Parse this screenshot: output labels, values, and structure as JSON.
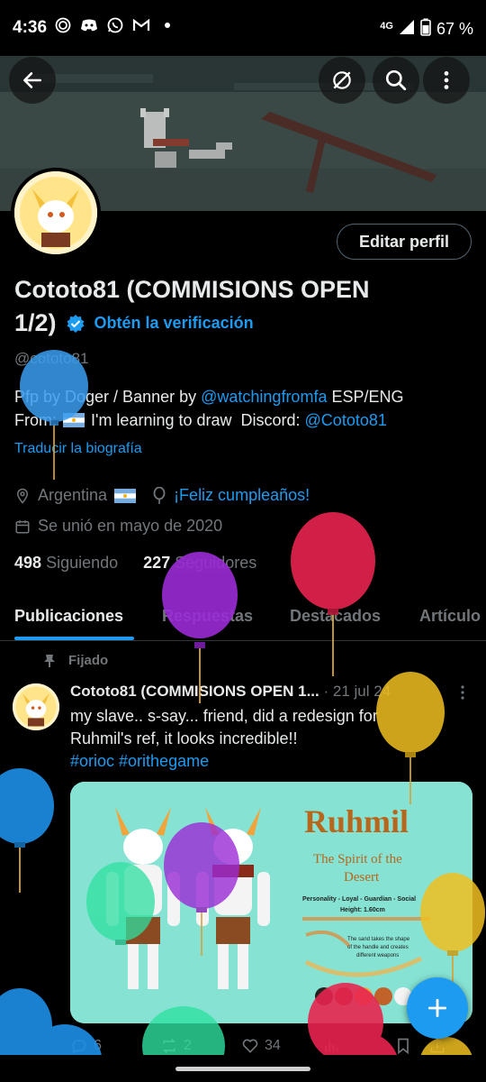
{
  "status_bar": {
    "time": "4:36",
    "network": "4G",
    "battery": "67 %",
    "notification_icons": [
      "signal-app-icon",
      "discord-icon",
      "whatsapp-icon",
      "gmail-icon"
    ]
  },
  "profile": {
    "name_line1": "Cototo81 (COMMISIONS OPEN",
    "name_line2": "1/2)",
    "verify_cta": "Obtén la verificación",
    "handle": "@cototo81",
    "edit_button": "Editar perfil",
    "bio": {
      "seg1": "Pfp by Doger / Banner by ",
      "banner_link": "@watchingfromfa",
      "seg2": "  ESP/ENG",
      "seg3": "From: ",
      "seg4": " I'm learning to draw  Discord: ",
      "discord_link": "@Cototo81"
    },
    "translate": "Traducir la biografía",
    "location": "Argentina",
    "birthday": "¡Feliz cumpleaños!",
    "joined": "Se unió en mayo de 2020",
    "following_count": "498",
    "following_label": "Siguiendo",
    "followers_count": "227",
    "followers_label": "Seguidores"
  },
  "tabs": [
    "Publicaciones",
    "Respuestas",
    "Destacados",
    "Artículo"
  ],
  "post": {
    "pinned_label": "Fijado",
    "author": "Cototo81 (COMMISIONS OPEN 1...",
    "date": "· 21 jul 24",
    "text_line1": "my slave.. s-say... friend, did a redesign for",
    "text_line2": "Ruhmil's ref, it looks incredible!!",
    "hashtags": "#orioc #orithegame",
    "image": {
      "title": "Ruhmil",
      "subtitle_line1": "The Spirit of the",
      "subtitle_line2": "Desert",
      "traits": "Personality - Loyal - Guardian - Social",
      "height": "Height: 1.60cm",
      "note_line1": "The sand takes the shape",
      "note_line2": "of the handle and creates",
      "note_line3": "different weapons"
    },
    "replies": "6",
    "reposts": "2",
    "likes": "34"
  },
  "colors": {
    "accent": "#1d9bf0",
    "muted": "#71767b",
    "text": "#e7e9ea",
    "border": "#2f3336"
  }
}
